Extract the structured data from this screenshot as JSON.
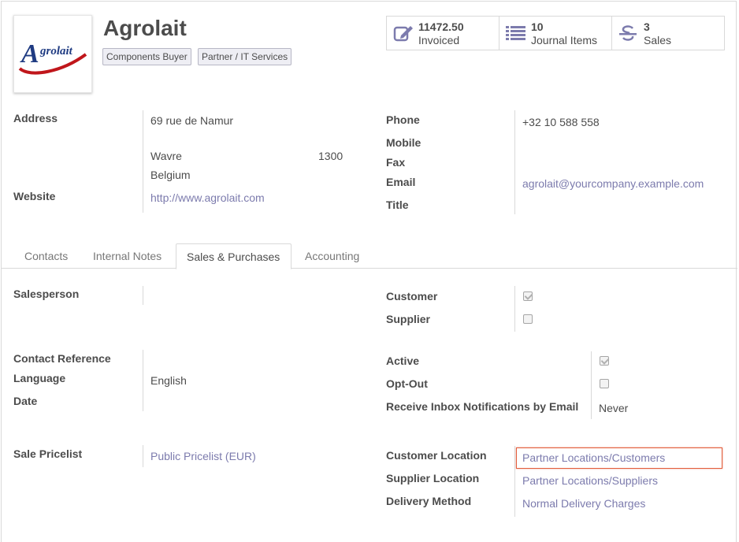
{
  "partner": {
    "name": "Agrolait",
    "logo_text": "grolait",
    "logo_initial": "A",
    "tags": [
      "Components Buyer",
      "Partner / IT Services"
    ]
  },
  "stats": [
    {
      "value": "11472.50",
      "label": "Invoiced",
      "icon": "edit-icon"
    },
    {
      "value": "10",
      "label": "Journal Items",
      "icon": "list-icon"
    },
    {
      "value": "3",
      "label": "Sales",
      "icon": "strikethrough-icon"
    }
  ],
  "address": {
    "label": "Address",
    "street": "69 rue de Namur",
    "city": "Wavre",
    "zip": "1300",
    "country": "Belgium"
  },
  "website": {
    "label": "Website",
    "value": "http://www.agrolait.com"
  },
  "contact": {
    "phone_label": "Phone",
    "phone": "+32 10 588 558",
    "mobile_label": "Mobile",
    "fax_label": "Fax",
    "email_label": "Email",
    "email": "agrolait@yourcompany.example.com",
    "title_label": "Title"
  },
  "tabs": [
    "Contacts",
    "Internal Notes",
    "Sales & Purchases",
    "Accounting"
  ],
  "active_tab": "Sales & Purchases",
  "sales": {
    "salesperson_label": "Salesperson",
    "customer_label": "Customer",
    "customer_checked": true,
    "supplier_label": "Supplier",
    "supplier_checked": false,
    "contact_reference_label": "Contact Reference",
    "language_label": "Language",
    "language": "English",
    "date_label": "Date",
    "active_label": "Active",
    "active_checked": true,
    "optout_label": "Opt-Out",
    "optout_checked": false,
    "notifications_label": "Receive Inbox Notifications by Email",
    "notifications": "Never",
    "pricelist_label": "Sale Pricelist",
    "pricelist": "Public Pricelist (EUR)",
    "customer_location_label": "Customer Location",
    "customer_location": "Partner Locations/Customers",
    "supplier_location_label": "Supplier Location",
    "supplier_location": "Partner Locations/Suppliers",
    "delivery_method_label": "Delivery Method",
    "delivery_method": "Normal Delivery Charges"
  },
  "colors": {
    "accent": "#7c7bad",
    "highlight": "#e25d3c",
    "logo_red": "#c0161b",
    "logo_blue": "#1f3b82"
  }
}
